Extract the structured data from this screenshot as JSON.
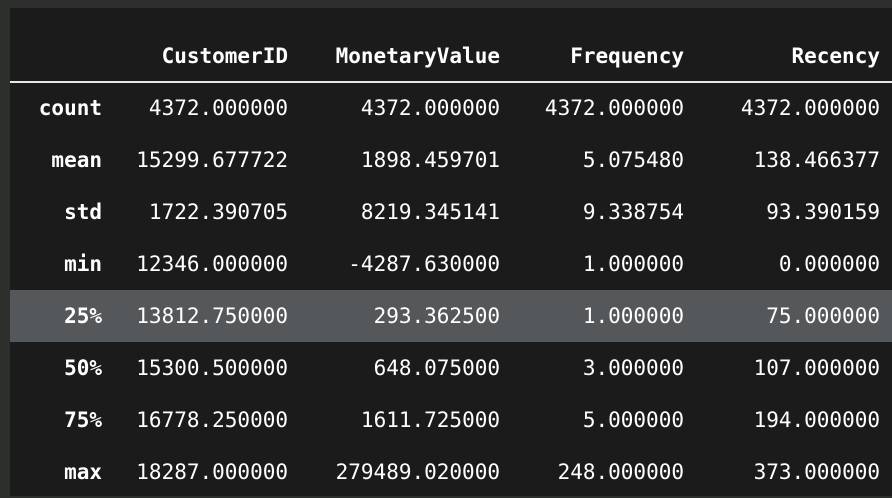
{
  "table": {
    "index_header": "",
    "columns": [
      "CustomerID",
      "MonetaryValue",
      "Frequency",
      "Recency"
    ],
    "rows": [
      {
        "label": "count",
        "values": [
          "4372.000000",
          "4372.000000",
          "4372.000000",
          "4372.000000"
        ]
      },
      {
        "label": "mean",
        "values": [
          "15299.677722",
          "1898.459701",
          "5.075480",
          "138.466377"
        ]
      },
      {
        "label": "std",
        "values": [
          "1722.390705",
          "8219.345141",
          "9.338754",
          "93.390159"
        ]
      },
      {
        "label": "min",
        "values": [
          "12346.000000",
          "-4287.630000",
          "1.000000",
          "0.000000"
        ]
      },
      {
        "label": "25%",
        "values": [
          "13812.750000",
          "293.362500",
          "1.000000",
          "75.000000"
        ]
      },
      {
        "label": "50%",
        "values": [
          "15300.500000",
          "648.075000",
          "3.000000",
          "107.000000"
        ]
      },
      {
        "label": "75%",
        "values": [
          "16778.250000",
          "1611.725000",
          "5.000000",
          "194.000000"
        ]
      },
      {
        "label": "max",
        "values": [
          "18287.000000",
          "279489.020000",
          "248.000000",
          "373.000000"
        ]
      }
    ],
    "highlighted_row": "25%"
  },
  "colors": {
    "page_background": "#2c2e2b",
    "panel_background": "#1b1b1b",
    "header_rule": "#e8e8e8",
    "hover_row": "#55585b",
    "text": "#ffffff"
  }
}
